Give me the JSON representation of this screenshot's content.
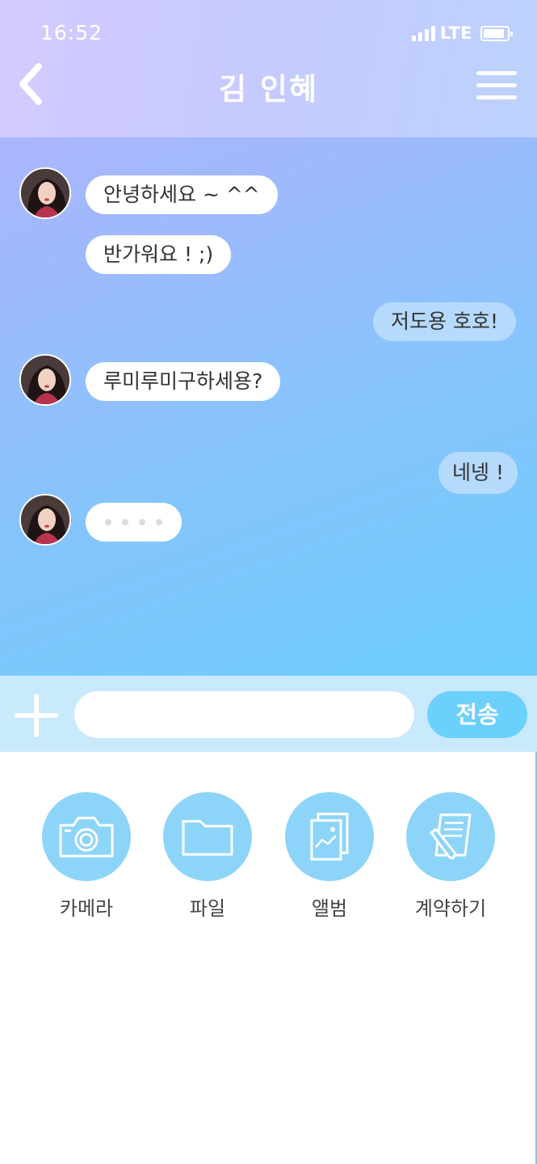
{
  "status_bar": {
    "time": "16:52",
    "network": "LTE"
  },
  "header": {
    "title": "김 인혜",
    "back_icon": "chevron-left-icon",
    "menu_icon": "hamburger-menu-icon"
  },
  "messages": [
    {
      "from": "them",
      "text": "안녕하세요 ~ ^^",
      "avatar": true
    },
    {
      "from": "them",
      "text": "반가워요 ! ;)",
      "avatar": false
    },
    {
      "from": "me",
      "text": "저도용 호호!"
    },
    {
      "from": "them",
      "text": "루미루미구하세용?",
      "avatar": true
    },
    {
      "from": "me",
      "text": "네넹 !"
    },
    {
      "from": "them",
      "typing": true,
      "avatar": true
    }
  ],
  "input": {
    "value": "",
    "placeholder": "",
    "send_label": "전송"
  },
  "attach_menu": [
    {
      "label": "카메라",
      "icon": "camera-icon"
    },
    {
      "label": "파일",
      "icon": "folder-icon"
    },
    {
      "label": "앨범",
      "icon": "album-icon"
    },
    {
      "label": "계약하기",
      "icon": "contract-icon"
    }
  ],
  "colors": {
    "header_gradient": [
      "#d4cbfe",
      "#bcd2fd"
    ],
    "chat_gradient": [
      "#b9b4ff",
      "#6ccdfd"
    ],
    "incoming_bubble": "#ffffff",
    "outgoing_bubble": "#b6dafc",
    "send_button": "#6cd0fd",
    "icon_circle": "#8dd4f9"
  }
}
